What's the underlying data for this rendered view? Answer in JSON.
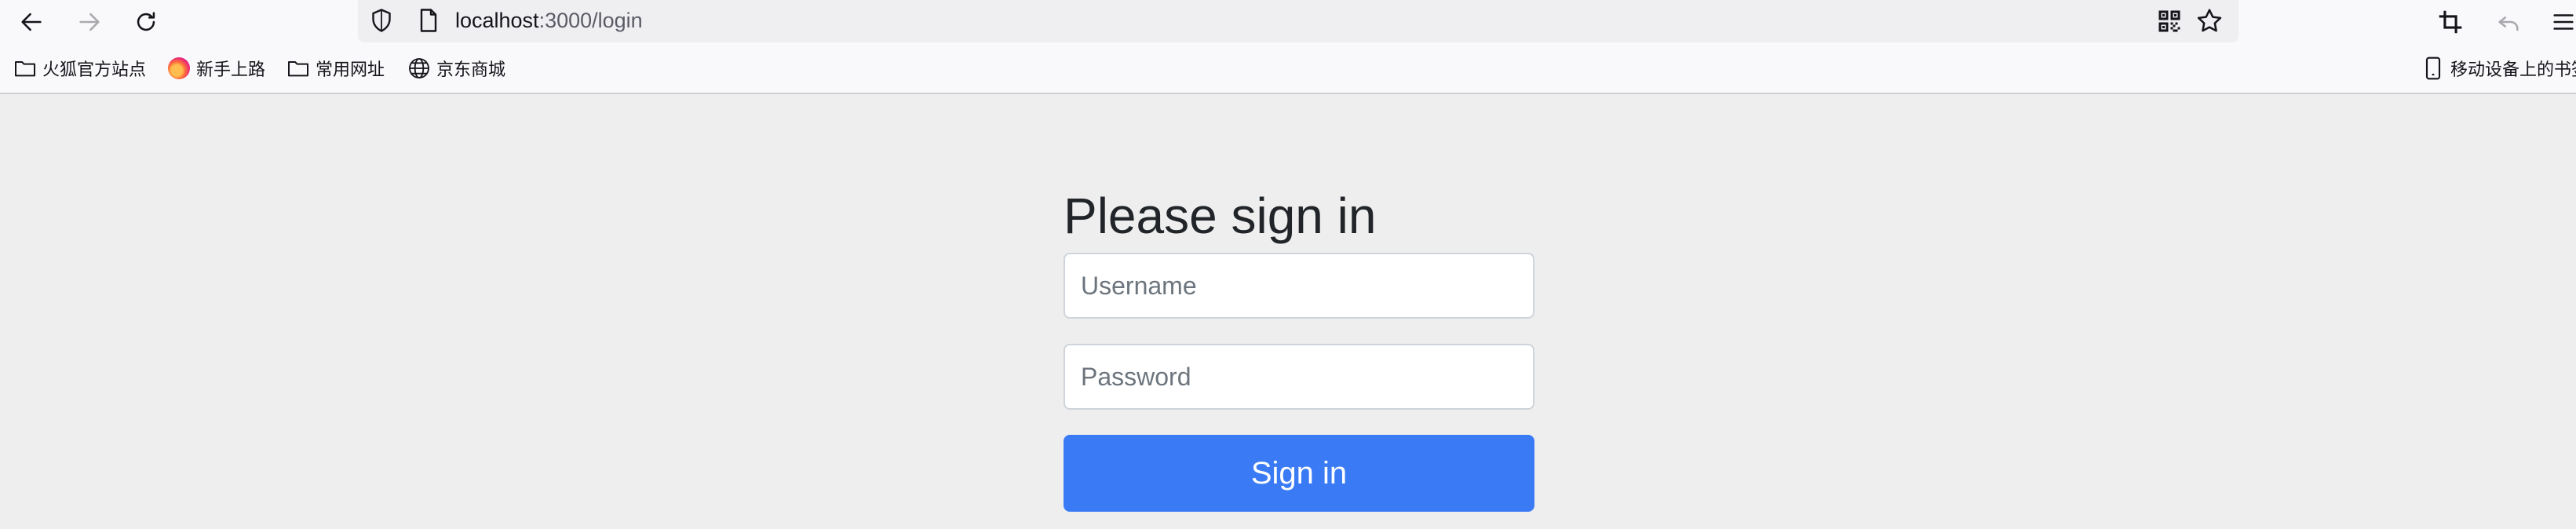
{
  "browser": {
    "url_host": "localhost",
    "url_path": ":3000/login",
    "nav_icons": [
      "back-arrow-icon",
      "forward-arrow-icon",
      "reload-icon"
    ],
    "url_icons": [
      "shield-icon",
      "page-icon",
      "qr-code-icon",
      "star-icon"
    ],
    "right_icons": [
      "crop-icon",
      "undo-icon",
      "hamburger-menu-icon"
    ]
  },
  "bookmarks": [
    {
      "label": "火狐官方站点",
      "icon": "folder-icon"
    },
    {
      "label": "新手上路",
      "icon": "firefox-logo-icon"
    },
    {
      "label": "常用网址",
      "icon": "folder-icon"
    },
    {
      "label": "京东商城",
      "icon": "globe-icon"
    }
  ],
  "mobile_bookmarks": {
    "label": "移动设备上的书签",
    "icon": "mobile-device-icon"
  },
  "form": {
    "heading": "Please sign in",
    "username_placeholder": "Username",
    "password_placeholder": "Password",
    "submit_label": "Sign in"
  },
  "colors": {
    "page_background": "#eeeeee",
    "button_background": "#3a7bf5",
    "button_text": "#ffffff",
    "heading_text": "#212529"
  }
}
